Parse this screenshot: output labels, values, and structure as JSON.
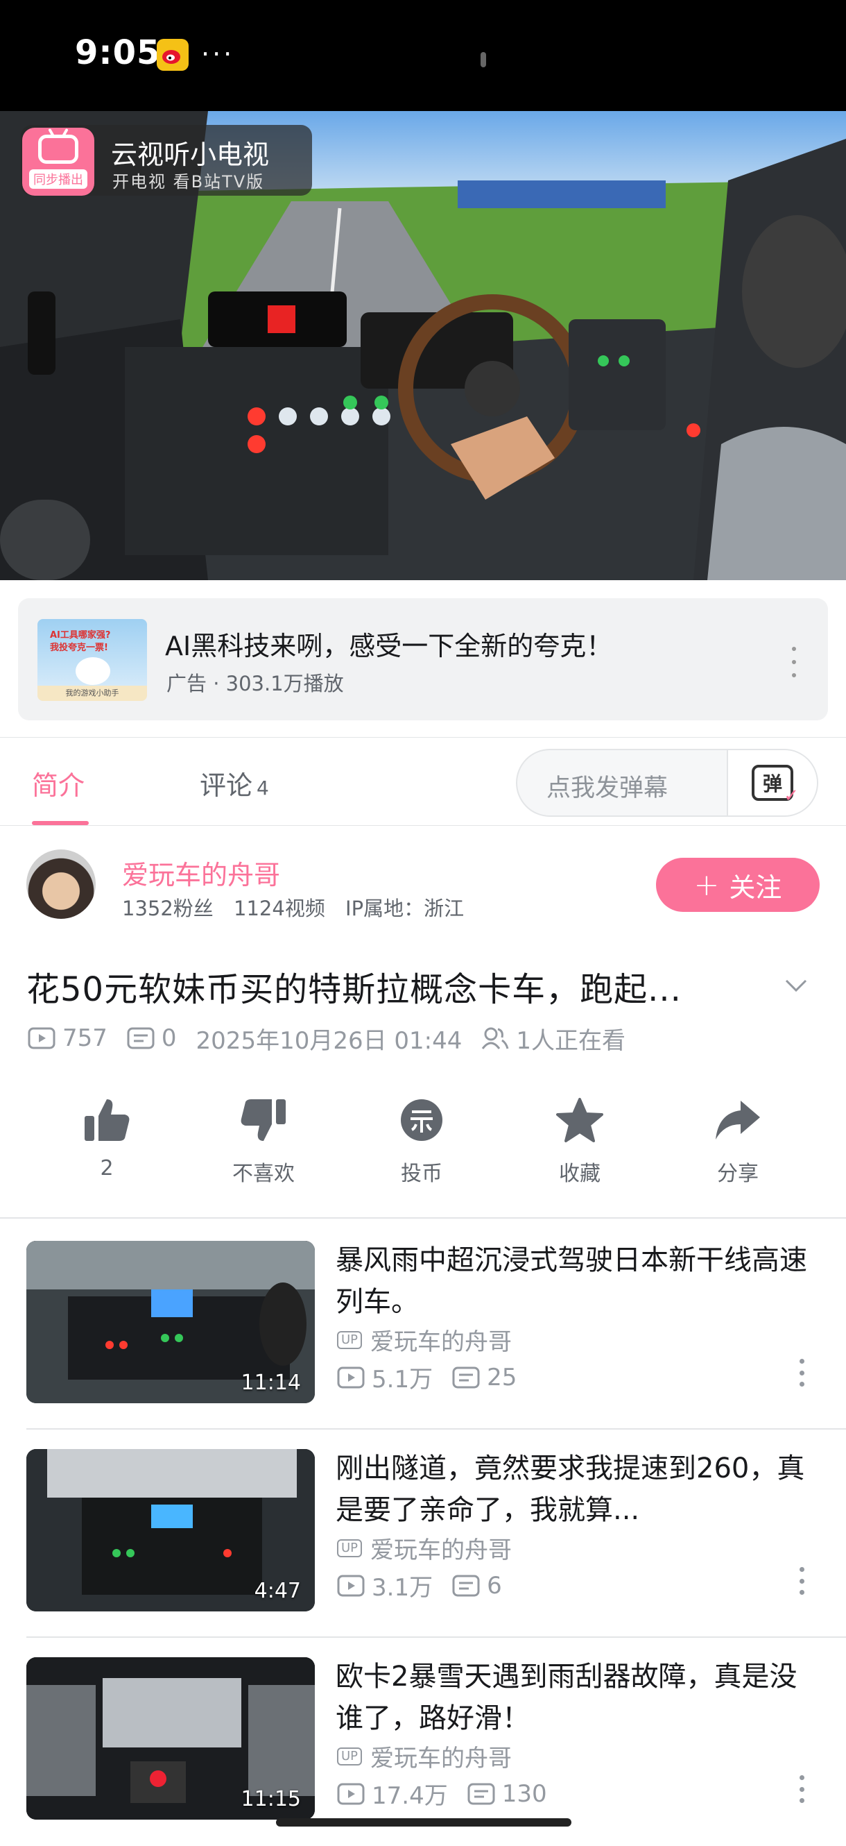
{
  "status_bar": {
    "time": "9:05",
    "dots": "···"
  },
  "tv_badge": {
    "sync_label": "同步播出",
    "title": "云视听小电视",
    "subtitle": "开电视 看B站TV版"
  },
  "ad": {
    "thumb_line1": "AI工具哪家强?",
    "thumb_line2": "我投夸克一票!",
    "thumb_footer": "我的游戏小助手",
    "title": "AI黑科技来咧，感受一下全新的夸克！",
    "meta": "广告 · 303.1万播放"
  },
  "tabs": {
    "intro": "简介",
    "comments": "评论",
    "comments_count": "4"
  },
  "danmaku": {
    "placeholder": "点我发弹幕",
    "button_label": "弹"
  },
  "uploader": {
    "name": "爱玩车的舟哥",
    "stats": "1352粉丝  1124视频  IP属地：浙江",
    "follow_label": "关注",
    "follow_plus": "+"
  },
  "video": {
    "title": "花50元软妹币买的特斯拉概念卡车，跑起...",
    "views": "757",
    "danmaku_count": "0",
    "datetime": "2025年10月26日 01:44",
    "watching": "1人正在看"
  },
  "actions": [
    {
      "label": "2",
      "icon": "thumb-up-icon"
    },
    {
      "label": "不喜欢",
      "icon": "thumb-down-icon"
    },
    {
      "label": "投币",
      "icon": "coin-icon"
    },
    {
      "label": "收藏",
      "icon": "star-icon"
    },
    {
      "label": "分享",
      "icon": "share-icon"
    }
  ],
  "recommendations": [
    {
      "title": "暴风雨中超沉浸式驾驶日本新干线高速列车。",
      "duration": "11:14",
      "up_badge": "UP",
      "author": "爱玩车的舟哥",
      "views": "5.1万",
      "danmaku": "25"
    },
    {
      "title": "刚出隧道，竟然要求我提速到260，真是要了亲命了，我就算...",
      "duration": "4:47",
      "up_badge": "UP",
      "author": "爱玩车的舟哥",
      "views": "3.1万",
      "danmaku": "6"
    },
    {
      "title": "欧卡2暴雪天遇到雨刮器故障，真是没谁了，路好滑！",
      "duration": "11:15",
      "up_badge": "UP",
      "author": "爱玩车的舟哥",
      "views": "17.4万",
      "danmaku": "130"
    }
  ],
  "colors": {
    "accent": "#fb7299",
    "text": "#18191c",
    "muted": "#9499a0"
  }
}
